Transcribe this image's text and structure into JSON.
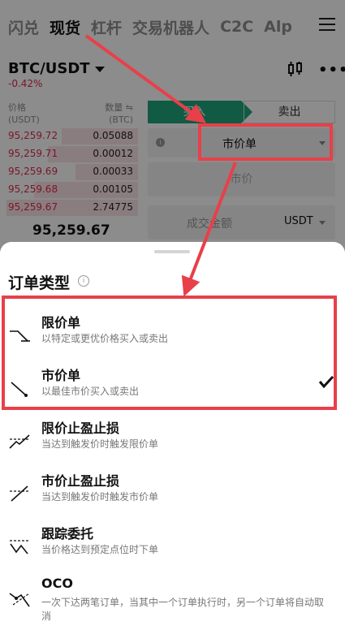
{
  "nav": {
    "tabs": [
      "闪兑",
      "现货",
      "杠杆",
      "交易机器人",
      "C2C",
      "Alp"
    ],
    "active_index": 1
  },
  "market": {
    "pair": "BTC/USDT",
    "change": "-0.42%"
  },
  "orderbook": {
    "price_header": "价格",
    "price_unit": "(USDT)",
    "qty_header": "数量 ⇋",
    "qty_unit": "(BTC)",
    "rows": [
      {
        "price": "95,259.72",
        "qty": "0.05088",
        "depth": 0.55
      },
      {
        "price": "95,259.71",
        "qty": "0.00012",
        "depth": 0.65
      },
      {
        "price": "95,259.69",
        "qty": "0.00033",
        "depth": 0.45
      },
      {
        "price": "95,259.68",
        "qty": "0.00105",
        "depth": 0.75
      },
      {
        "price": "95,259.67",
        "qty": "2.74775",
        "depth": 0.95
      }
    ],
    "last_price": "95,259.67"
  },
  "trade_form": {
    "buy_label": "买入",
    "sell_label": "卖出",
    "order_type_value": "市价单",
    "price_placeholder": "市价",
    "amount_label": "成交金额",
    "amount_unit": "USDT"
  },
  "sheet": {
    "title": "订单类型",
    "options": [
      {
        "name": "限价单",
        "desc": "以特定或更优价格买入或卖出",
        "icon": "limit-order-icon",
        "selected": false
      },
      {
        "name": "市价单",
        "desc": "以最佳市价买入或卖出",
        "icon": "market-order-icon",
        "selected": true
      },
      {
        "name": "限价止盈止损",
        "desc": "当达到触发价时触发限价单",
        "icon": "stop-limit-icon",
        "selected": false
      },
      {
        "name": "市价止盈止损",
        "desc": "当达到触发价时触发市价单",
        "icon": "stop-market-icon",
        "selected": false
      },
      {
        "name": "跟踪委托",
        "desc": "当价格达到预定点位时下单",
        "icon": "trailing-order-icon",
        "selected": false
      },
      {
        "name": "OCO",
        "desc": "一次下达两笔订单，当其中一个订单执行时，另一个订单将自动取消",
        "icon": "oco-icon",
        "selected": false
      }
    ]
  },
  "colors": {
    "buy": "#1fa47c",
    "sell": "#e0294a",
    "annotation": "#e8404a"
  }
}
